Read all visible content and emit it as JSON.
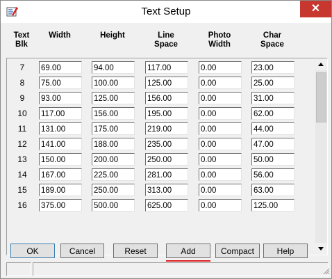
{
  "window": {
    "title": "Text Setup",
    "close_glyph": "✕",
    "app_icon": "text-setup-app-icon"
  },
  "columns": [
    {
      "label": "Text\nBlk"
    },
    {
      "label": "Width"
    },
    {
      "label": "Height"
    },
    {
      "label": "Line\nSpace"
    },
    {
      "label": "Photo\nWidth"
    },
    {
      "label": "Char\nSpace"
    }
  ],
  "rows": [
    {
      "blk": "7",
      "width": "69.00",
      "height": "94.00",
      "line_space": "117.00",
      "photo_width": "0.00",
      "char_space": "23.00"
    },
    {
      "blk": "8",
      "width": "75.00",
      "height": "100.00",
      "line_space": "125.00",
      "photo_width": "0.00",
      "char_space": "25.00"
    },
    {
      "blk": "9",
      "width": "93.00",
      "height": "125.00",
      "line_space": "156.00",
      "photo_width": "0.00",
      "char_space": "31.00"
    },
    {
      "blk": "10",
      "width": "117.00",
      "height": "156.00",
      "line_space": "195.00",
      "photo_width": "0.00",
      "char_space": "62.00"
    },
    {
      "blk": "11",
      "width": "131.00",
      "height": "175.00",
      "line_space": "219.00",
      "photo_width": "0.00",
      "char_space": "44.00"
    },
    {
      "blk": "12",
      "width": "141.00",
      "height": "188.00",
      "line_space": "235.00",
      "photo_width": "0.00",
      "char_space": "47.00"
    },
    {
      "blk": "13",
      "width": "150.00",
      "height": "200.00",
      "line_space": "250.00",
      "photo_width": "0.00",
      "char_space": "50.00"
    },
    {
      "blk": "14",
      "width": "167.00",
      "height": "225.00",
      "line_space": "281.00",
      "photo_width": "0.00",
      "char_space": "56.00"
    },
    {
      "blk": "15",
      "width": "189.00",
      "height": "250.00",
      "line_space": "313.00",
      "photo_width": "0.00",
      "char_space": "63.00"
    },
    {
      "blk": "16",
      "width": "375.00",
      "height": "500.00",
      "line_space": "625.00",
      "photo_width": "0.00",
      "char_space": "125.00"
    }
  ],
  "buttons": {
    "ok": "OK",
    "cancel": "Cancel",
    "reset": "Reset",
    "add": "Add",
    "compact": "Compact",
    "help": "Help"
  },
  "colors": {
    "close": "#c7372f",
    "highlight_underline": "#e02020"
  }
}
